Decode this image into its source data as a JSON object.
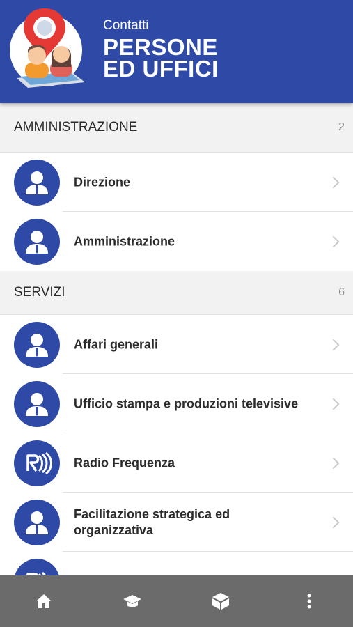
{
  "header": {
    "subtitle": "Contatti",
    "title": "PERSONE\nED UFFICI",
    "logo_icon": "contacts-people-location-icon"
  },
  "sections": [
    {
      "title": "AMMINISTRAZIONE",
      "count": "2",
      "items": [
        {
          "label": "Direzione",
          "icon": "person-icon"
        },
        {
          "label": "Amministrazione",
          "icon": "person-icon"
        }
      ]
    },
    {
      "title": "SERVIZI",
      "count": "6",
      "items": [
        {
          "label": "Affari generali",
          "icon": "person-icon"
        },
        {
          "label": "Ufficio stampa e produzioni televisive",
          "icon": "person-icon"
        },
        {
          "label": "Radio Frequenza",
          "icon": "radio-frequenza-icon"
        },
        {
          "label": "Facilitazione strategica ed organizzativa",
          "icon": "person-icon"
        },
        {
          "label": "",
          "icon": "radio-frequenza-icon"
        }
      ]
    }
  ],
  "bottom_nav": [
    {
      "icon": "home-icon"
    },
    {
      "icon": "graduation-cap-icon"
    },
    {
      "icon": "cube-icon"
    },
    {
      "icon": "more-vertical-icon"
    }
  ],
  "colors": {
    "primary": "#2f4aa6",
    "section_bg": "#f2f2f2",
    "bottom_nav_bg": "#6b6b6b",
    "text": "#2b2b2b"
  }
}
